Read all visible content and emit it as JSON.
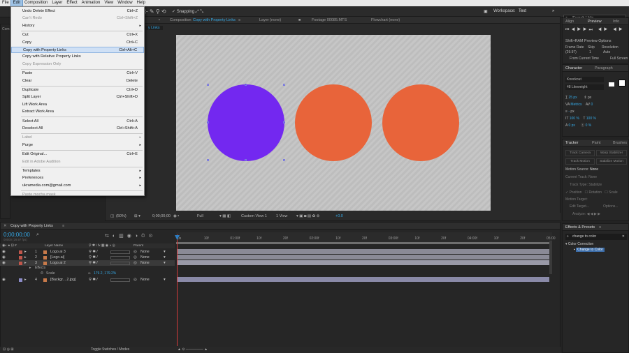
{
  "menubar": {
    "items": [
      "File",
      "Edit",
      "Composition",
      "Layer",
      "Effect",
      "Animation",
      "View",
      "Window",
      "Help"
    ]
  },
  "toolbar": {
    "snapping": "Snapping",
    "workspace_label": "Workspace:",
    "workspace_value": "Text",
    "search_placeholder": "Search Help"
  },
  "edit_menu": {
    "items": [
      {
        "label": "Undo Delete Effect",
        "shortcut": "Ctrl+Z"
      },
      {
        "label": "Can't Redo",
        "shortcut": "Ctrl+Shift+Z",
        "disabled": true
      },
      {
        "label": "History",
        "submenu": true
      },
      {
        "label": "Cut",
        "shortcut": "Ctrl+X"
      },
      {
        "label": "Copy",
        "shortcut": "Ctrl+C"
      },
      {
        "label": "Copy with Property Links",
        "shortcut": "Ctrl+Alt+C",
        "hover": true
      },
      {
        "label": "Copy with Relative Property Links",
        "shortcut": ""
      },
      {
        "label": "Copy Expression Only",
        "shortcut": "",
        "disabled": true
      },
      {
        "label": "Paste",
        "shortcut": "Ctrl+V"
      },
      {
        "label": "Clear",
        "shortcut": "Delete"
      },
      {
        "label": "Duplicate",
        "shortcut": "Ctrl+D"
      },
      {
        "label": "Split Layer",
        "shortcut": "Ctrl+Shift+D"
      },
      {
        "label": "Lift Work Area",
        "shortcut": ""
      },
      {
        "label": "Extract Work Area",
        "shortcut": ""
      },
      {
        "label": "Select All",
        "shortcut": "Ctrl+A"
      },
      {
        "label": "Deselect All",
        "shortcut": "Ctrl+Shift+A"
      },
      {
        "label": "Label",
        "submenu": true,
        "disabled": true
      },
      {
        "label": "Purge",
        "submenu": true
      },
      {
        "label": "Edit Original...",
        "shortcut": "Ctrl+E"
      },
      {
        "label": "Edit in Adobe Audition",
        "shortcut": "",
        "disabled": true
      },
      {
        "label": "Templates",
        "submenu": true
      },
      {
        "label": "Preferences",
        "submenu": true
      },
      {
        "label": "ukramedia.com@gmail.com",
        "submenu": true
      },
      {
        "label": "Paste mocha mask",
        "shortcut": "",
        "disabled": true
      }
    ]
  },
  "composition_tabs": {
    "comp_label": "Composition",
    "comp_name": "Copy with Property Links",
    "layer": "Layer  (none)",
    "footage": "Footage  00085.MTS",
    "flowchart": "Flowchart  (none)",
    "sub_tab": "y Links"
  },
  "viewer_footer": {
    "zoom": "(50%)",
    "timecode": "0;00;00;00",
    "quality": "Full",
    "view": "Custom View 1",
    "views": "1 View",
    "exposure": "+0.0"
  },
  "circles": [
    {
      "name": "purple-circle",
      "color": "#7328f0"
    },
    {
      "name": "orange-circle-2",
      "color": "#e8643a"
    },
    {
      "name": "orange-circle-3",
      "color": "#e8643a"
    }
  ],
  "right_panels": {
    "tabs_top": [
      "Align",
      "Preview",
      "Info"
    ],
    "preview_options": "Shift+RAM Preview Options",
    "preview_labels": [
      "Frame Rate",
      "Skip",
      "Resolution"
    ],
    "preview_values": [
      "(29.97)",
      "1",
      "Auto"
    ],
    "from_current": "From Current Time",
    "full_screen": "Full Screen",
    "char_tabs": [
      "Character",
      "Paragraph"
    ],
    "font": "Knockout",
    "font_style": "48 Liteweight",
    "font_size": "px",
    "tracker_tabs": [
      "Tracker",
      "Paint",
      "Brushes"
    ],
    "tracker_buttons": [
      "Track Camera",
      "Warp Stabilizer",
      "Track Motion",
      "Stabilize Motion"
    ],
    "motion_source_label": "Motion Source:",
    "motion_source_value": "None",
    "current_track_label": "Current Track:",
    "current_track_value": "None",
    "track_type_label": "Track Type:",
    "track_type_value": "Stabilize",
    "checks": [
      "Position",
      "Rotation",
      "Scale"
    ],
    "motion_target": "Motion Target:",
    "edit_target": "Edit Target...",
    "options": "Options...",
    "analyze": "Analyze:",
    "effects_tab": "Effects & Presets",
    "effects_search": "change to color",
    "effects_group": "Color Correction",
    "effects_item": "Change to Color"
  },
  "timeline": {
    "tab": "Copy with Property Links",
    "timecode": "0;00;00;00",
    "timecode_sub": "00000 (29.97 fps)",
    "col_layer_name": "Layer Name",
    "col_parent": "Parent",
    "ruler": [
      "0s",
      "10f",
      "01:00f",
      "10f",
      "20f",
      "02:00f",
      "10f",
      "20f",
      "03:00f",
      "10f",
      "20f",
      "04:00f",
      "10f",
      "20f",
      "05:00"
    ],
    "layers": [
      {
        "num": "1",
        "name": "Logo.ai 3",
        "parent": "None",
        "color": "#c0564b"
      },
      {
        "num": "2",
        "name": "[Logo.ai]",
        "parent": "None",
        "color": "#c0564b"
      },
      {
        "num": "3",
        "name": "Logo.ai 2",
        "parent": "None",
        "color": "#c0564b"
      },
      {
        "num": "4",
        "name": "[Backgr....2.jpg]",
        "parent": "None",
        "color": "#8c8cc8"
      }
    ],
    "effects_label": "Effects",
    "scale_label": "Scale",
    "scale_value": "179.2, 179.2%",
    "toggle_label": "Toggle Switches / Modes"
  }
}
